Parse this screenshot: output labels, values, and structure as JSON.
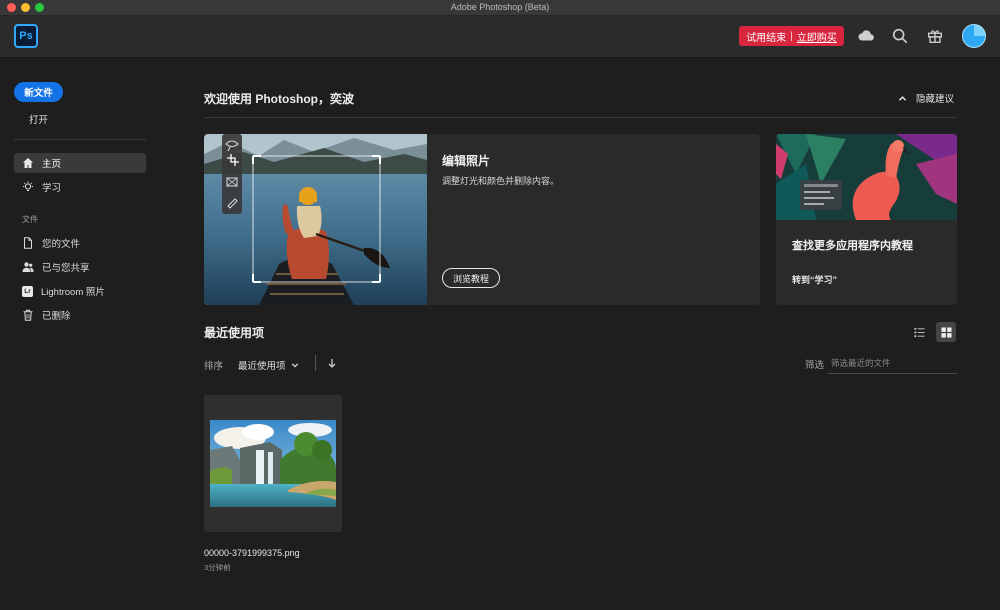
{
  "window": {
    "title": "Adobe Photoshop (Beta)"
  },
  "header": {
    "logo_text": "Ps",
    "trial_text": "试用结束",
    "trial_sep": "|",
    "buy_text": "立即购买",
    "icons": [
      "cloud-icon",
      "search-icon",
      "gift-icon"
    ],
    "accent_color": "#d8263f"
  },
  "sidebar": {
    "new_file": "新文件",
    "open": "打开",
    "nav": [
      {
        "label": "主页",
        "icon": "home-icon",
        "active": true
      },
      {
        "label": "学习",
        "icon": "lightbulb-icon",
        "active": false
      }
    ],
    "files_heading": "文件",
    "files": [
      {
        "label": "您的文件",
        "icon": "document-icon"
      },
      {
        "label": "已与您共享",
        "icon": "shared-user-icon"
      },
      {
        "label": "Lightroom 照片",
        "icon": "lightroom-icon"
      },
      {
        "label": "已删除",
        "icon": "trash-icon"
      }
    ]
  },
  "main": {
    "welcome": "欢迎使用 Photoshop，奕波",
    "hide_suggestions": "隐藏建议",
    "card_edit": {
      "title": "编辑照片",
      "description": "调整灯光和颜色并删除内容。",
      "button": "浏览教程"
    },
    "card_learn": {
      "title": "查找更多应用程序内教程",
      "link": "转到“学习”"
    },
    "recent": {
      "title": "最近使用项",
      "sort_label": "排序",
      "sort_value": "最近使用项",
      "filter_label": "筛选",
      "filter_placeholder": "筛选最近的文件",
      "files": [
        {
          "name": "00000-3791999375.png",
          "time": "3分钟前"
        }
      ]
    }
  }
}
